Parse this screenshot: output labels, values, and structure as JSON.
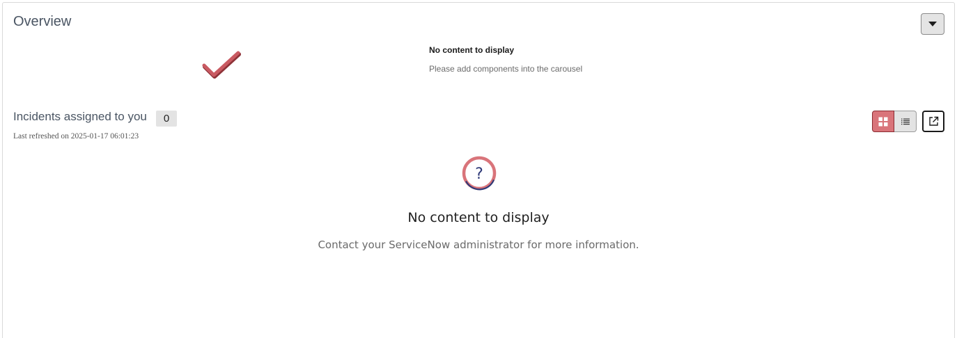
{
  "overview": {
    "title": "Overview",
    "collapse_icon": "caret-down-icon"
  },
  "carousel": {
    "icon": "checkmark-icon",
    "empty_title": "No content to display",
    "empty_message": "Please add components into the carousel"
  },
  "incidents": {
    "title": "Incidents assigned to you",
    "count": "0",
    "last_refreshed": "Last refreshed on 2025-01-17 06:01:23",
    "view_modes": [
      {
        "name": "grid-view",
        "icon": "grid-icon",
        "selected": true
      },
      {
        "name": "list-view",
        "icon": "list-icon",
        "selected": false
      }
    ],
    "open_icon": "external-link-icon",
    "empty_icon": "question-circle-icon",
    "empty_title": "No content to display",
    "empty_message": "Contact your ServiceNow administrator for more information."
  },
  "colors": {
    "accent": "#d9747a",
    "accent_border": "#8a2a30",
    "check": "#c95a62",
    "question_ring": "#d9747a",
    "question_mark": "#2f3a78"
  }
}
